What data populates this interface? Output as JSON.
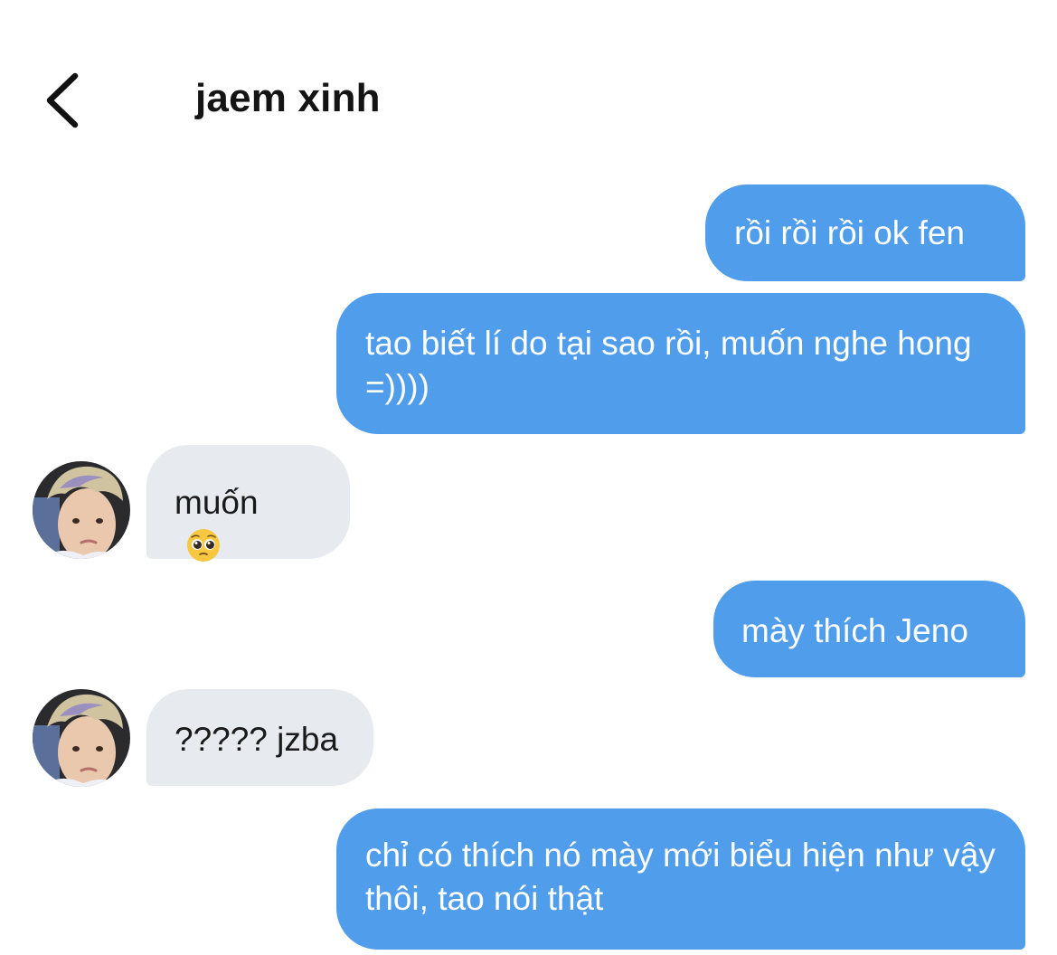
{
  "header": {
    "back_icon": "chevron-left-icon",
    "title": "jaem xinh"
  },
  "messages": [
    {
      "from": "me",
      "text": "rồi rồi rồi ok fen"
    },
    {
      "from": "me",
      "text": "tao biết lí do tại sao rồi, muốn nghe hong =))))"
    },
    {
      "from": "them",
      "text": "muốn",
      "emoji": "pleading-face-emoji"
    },
    {
      "from": "me",
      "text": "mày thích Jeno"
    },
    {
      "from": "them",
      "text": "????? jzba"
    },
    {
      "from": "me",
      "text": "chỉ có thích nó mày mới biểu hiện như vậy thôi, tao nói thật"
    }
  ],
  "colors": {
    "sent_bubble": "#4f9deb",
    "received_bubble": "#e7ebef",
    "background": "#ffffff"
  }
}
